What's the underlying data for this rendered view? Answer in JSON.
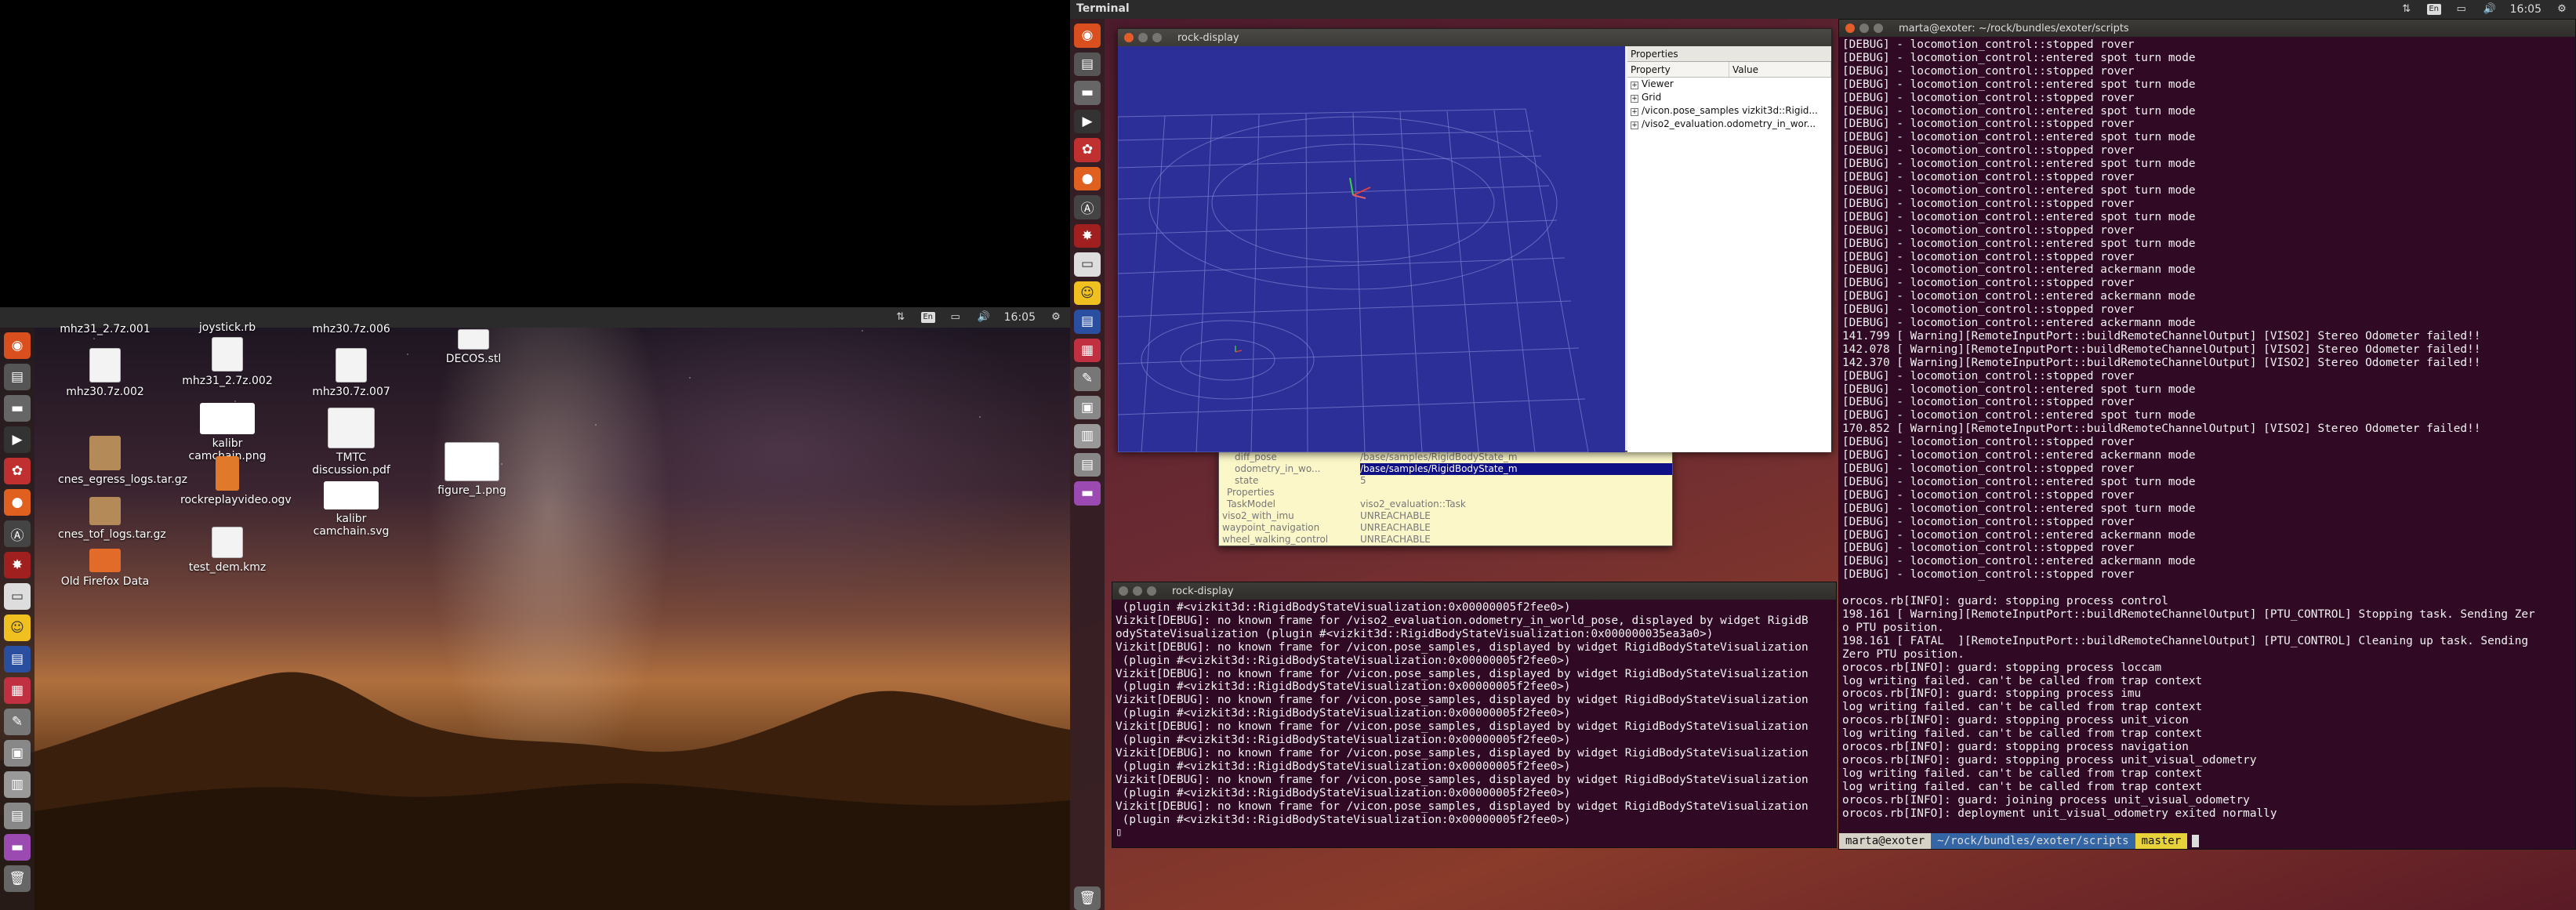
{
  "left_screen": {
    "topbar": {
      "clock": "16:05",
      "keyboard": "En"
    },
    "desktop_icons": [
      {
        "label": "mhz31_2.7z.001",
        "kind": "file"
      },
      {
        "label": "joystick.rb",
        "kind": "file"
      },
      {
        "label": "mhz30.7z.006",
        "kind": "file"
      },
      {
        "label": "mhz30.7z.002",
        "kind": "file"
      },
      {
        "label": "mhz31_2.7z.002",
        "kind": "file"
      },
      {
        "label": "mhz30.7z.007",
        "kind": "file"
      },
      {
        "label": "DECOS.stl",
        "kind": "file"
      },
      {
        "label": "kalibr camchain.png",
        "kind": "img"
      },
      {
        "label": "TMTC discussion.pdf",
        "kind": "file"
      },
      {
        "label": "cnes_egress_logs.tar.gz",
        "kind": "tar"
      },
      {
        "label": "figure_1.png",
        "kind": "plot"
      },
      {
        "label": "rockreplayvideo.ogv",
        "kind": "video"
      },
      {
        "label": "kalibr camchain.svg",
        "kind": "img"
      },
      {
        "label": "cnes_tof_logs.tar.gz",
        "kind": "tar"
      },
      {
        "label": "test_dem.kmz",
        "kind": "file"
      },
      {
        "label": "Old Firefox Data",
        "kind": "folder"
      }
    ]
  },
  "right_screen": {
    "topbar": {
      "title": "Terminal",
      "clock": "16:05",
      "keyboard": "En"
    },
    "rock_display_3d": {
      "title": "rock-display",
      "properties": {
        "header": "Properties",
        "col_property": "Property",
        "col_value": "Value",
        "rows": [
          "Viewer",
          "Grid",
          "/vicon.pose_samples vizkit3d::Rigid...",
          "/viso2_evaluation.odometry_in_wor..."
        ]
      }
    },
    "task_inspector": {
      "rows": [
        {
          "name": "diff_pose",
          "value": "/base/samples/RigidBodyState_m"
        },
        {
          "name": "odometry_in_wo...",
          "value": "/base/samples/RigidBodyState_m",
          "selected": true
        },
        {
          "name": "state",
          "value": "5"
        },
        {
          "name": "Properties",
          "value": ""
        },
        {
          "name": "TaskModel",
          "value": "viso2_evaluation::Task"
        },
        {
          "name": "viso2_with_imu",
          "value": "UNREACHABLE"
        },
        {
          "name": "waypoint_navigation",
          "value": "UNREACHABLE"
        },
        {
          "name": "wheel_walking_control",
          "value": "UNREACHABLE"
        }
      ]
    },
    "terminal_left": {
      "title": "rock-display",
      "lines": [
        " (plugin #<vizkit3d::RigidBodyStateVisualization:0x00000005f2fee0>)",
        "Vizkit[DEBUG]: no known frame for /viso2_evaluation.odometry_in_world_pose, displayed by widget RigidB",
        "odyStateVisualization (plugin #<vizkit3d::RigidBodyStateVisualization:0x000000035ea3a0>)",
        "Vizkit[DEBUG]: no known frame for /vicon.pose_samples, displayed by widget RigidBodyStateVisualization",
        " (plugin #<vizkit3d::RigidBodyStateVisualization:0x00000005f2fee0>)",
        "Vizkit[DEBUG]: no known frame for /vicon.pose_samples, displayed by widget RigidBodyStateVisualization",
        " (plugin #<vizkit3d::RigidBodyStateVisualization:0x00000005f2fee0>)",
        "Vizkit[DEBUG]: no known frame for /vicon.pose_samples, displayed by widget RigidBodyStateVisualization",
        " (plugin #<vizkit3d::RigidBodyStateVisualization:0x00000005f2fee0>)",
        "Vizkit[DEBUG]: no known frame for /vicon.pose_samples, displayed by widget RigidBodyStateVisualization",
        " (plugin #<vizkit3d::RigidBodyStateVisualization:0x00000005f2fee0>)",
        "Vizkit[DEBUG]: no known frame for /vicon.pose_samples, displayed by widget RigidBodyStateVisualization",
        " (plugin #<vizkit3d::RigidBodyStateVisualization:0x00000005f2fee0>)",
        "Vizkit[DEBUG]: no known frame for /vicon.pose_samples, displayed by widget RigidBodyStateVisualization",
        " (plugin #<vizkit3d::RigidBodyStateVisualization:0x00000005f2fee0>)",
        "Vizkit[DEBUG]: no known frame for /vicon.pose_samples, displayed by widget RigidBodyStateVisualization",
        " (plugin #<vizkit3d::RigidBodyStateVisualization:0x00000005f2fee0>)",
        "▯"
      ]
    },
    "terminal_right": {
      "title": "marta@exoter: ~/rock/bundles/exoter/scripts",
      "lines": [
        "[DEBUG] - locomotion_control::stopped rover",
        "[DEBUG] - locomotion_control::entered spot turn mode",
        "[DEBUG] - locomotion_control::stopped rover",
        "[DEBUG] - locomotion_control::entered spot turn mode",
        "[DEBUG] - locomotion_control::stopped rover",
        "[DEBUG] - locomotion_control::entered spot turn mode",
        "[DEBUG] - locomotion_control::stopped rover",
        "[DEBUG] - locomotion_control::entered spot turn mode",
        "[DEBUG] - locomotion_control::stopped rover",
        "[DEBUG] - locomotion_control::entered spot turn mode",
        "[DEBUG] - locomotion_control::stopped rover",
        "[DEBUG] - locomotion_control::entered spot turn mode",
        "[DEBUG] - locomotion_control::stopped rover",
        "[DEBUG] - locomotion_control::entered spot turn mode",
        "[DEBUG] - locomotion_control::stopped rover",
        "[DEBUG] - locomotion_control::entered spot turn mode",
        "[DEBUG] - locomotion_control::stopped rover",
        "[DEBUG] - locomotion_control::entered ackermann mode",
        "[DEBUG] - locomotion_control::stopped rover",
        "[DEBUG] - locomotion_control::entered ackermann mode",
        "[DEBUG] - locomotion_control::stopped rover",
        "[DEBUG] - locomotion_control::entered ackermann mode",
        "141.799 [ Warning][RemoteInputPort::buildRemoteChannelOutput] [VISO2] Stereo Odometer failed!!",
        "142.078 [ Warning][RemoteInputPort::buildRemoteChannelOutput] [VISO2] Stereo Odometer failed!!",
        "142.370 [ Warning][RemoteInputPort::buildRemoteChannelOutput] [VISO2] Stereo Odometer failed!!",
        "[DEBUG] - locomotion_control::stopped rover",
        "[DEBUG] - locomotion_control::entered spot turn mode",
        "[DEBUG] - locomotion_control::stopped rover",
        "[DEBUG] - locomotion_control::entered spot turn mode",
        "170.852 [ Warning][RemoteInputPort::buildRemoteChannelOutput] [VISO2] Stereo Odometer failed!!",
        "[DEBUG] - locomotion_control::stopped rover",
        "[DEBUG] - locomotion_control::entered ackermann mode",
        "[DEBUG] - locomotion_control::stopped rover",
        "[DEBUG] - locomotion_control::entered spot turn mode",
        "[DEBUG] - locomotion_control::stopped rover",
        "[DEBUG] - locomotion_control::entered spot turn mode",
        "[DEBUG] - locomotion_control::stopped rover",
        "[DEBUG] - locomotion_control::entered ackermann mode",
        "[DEBUG] - locomotion_control::stopped rover",
        "[DEBUG] - locomotion_control::entered ackermann mode",
        "[DEBUG] - locomotion_control::stopped rover",
        "",
        "orocos.rb[INFO]: guard: stopping process control",
        "198.161 [ Warning][RemoteInputPort::buildRemoteChannelOutput] [PTU_CONTROL] Stopping task. Sending Zer",
        "o PTU position.",
        "198.161 [ FATAL  ][RemoteInputPort::buildRemoteChannelOutput] [PTU_CONTROL] Cleaning up task. Sending",
        "Zero PTU position.",
        "orocos.rb[INFO]: guard: stopping process loccam",
        "log writing failed. can't be called from trap context",
        "orocos.rb[INFO]: guard: stopping process imu",
        "log writing failed. can't be called from trap context",
        "orocos.rb[INFO]: guard: stopping process unit_vicon",
        "log writing failed. can't be called from trap context",
        "orocos.rb[INFO]: guard: stopping process navigation",
        "orocos.rb[INFO]: guard: stopping process unit_visual_odometry",
        "log writing failed. can't be called from trap context",
        "log writing failed. can't be called from trap context",
        "orocos.rb[INFO]: guard: joining process unit_visual_odometry",
        "orocos.rb[INFO]: deployment unit_visual_odometry exited normally"
      ],
      "prompt": {
        "user": "marta@exoter",
        "path": "~/rock/bundles/exoter/scripts",
        "git": "master"
      }
    },
    "colors": {
      "terminal_bg": "#300a24",
      "viewport_bg": "#2c2f98",
      "accent": "#e35d2a"
    }
  }
}
